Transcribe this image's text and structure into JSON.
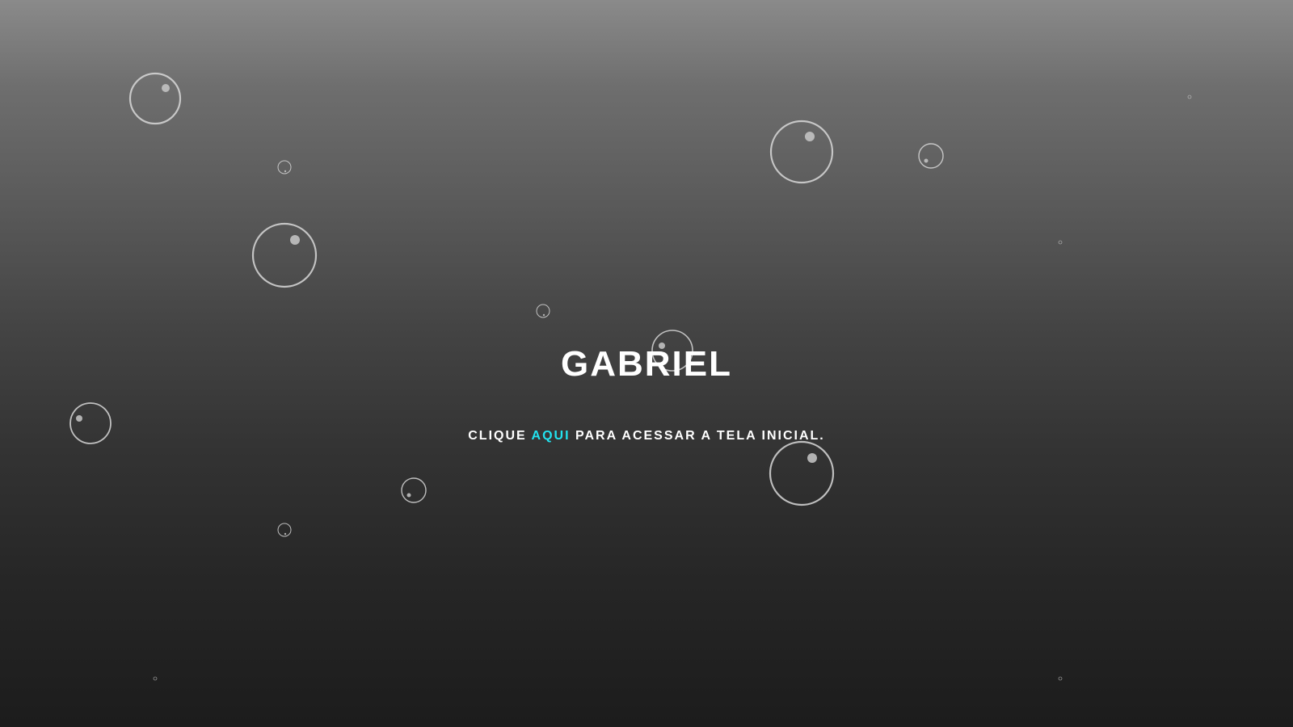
{
  "page": {
    "title": "GABRIEL",
    "subtitle_before": "CLIQUE ",
    "subtitle_link": "AQUI",
    "subtitle_after": " PARA ACESSAR A TELA INICIAL."
  },
  "colors": {
    "background_top": "#8a8a8a",
    "background_bottom": "#1c1c1c",
    "text": "#ffffff",
    "link": "#22e3f0",
    "bubble_stroke": "#d8d8d8"
  },
  "decoration": {
    "bubble_icon": "bubble-icon"
  }
}
